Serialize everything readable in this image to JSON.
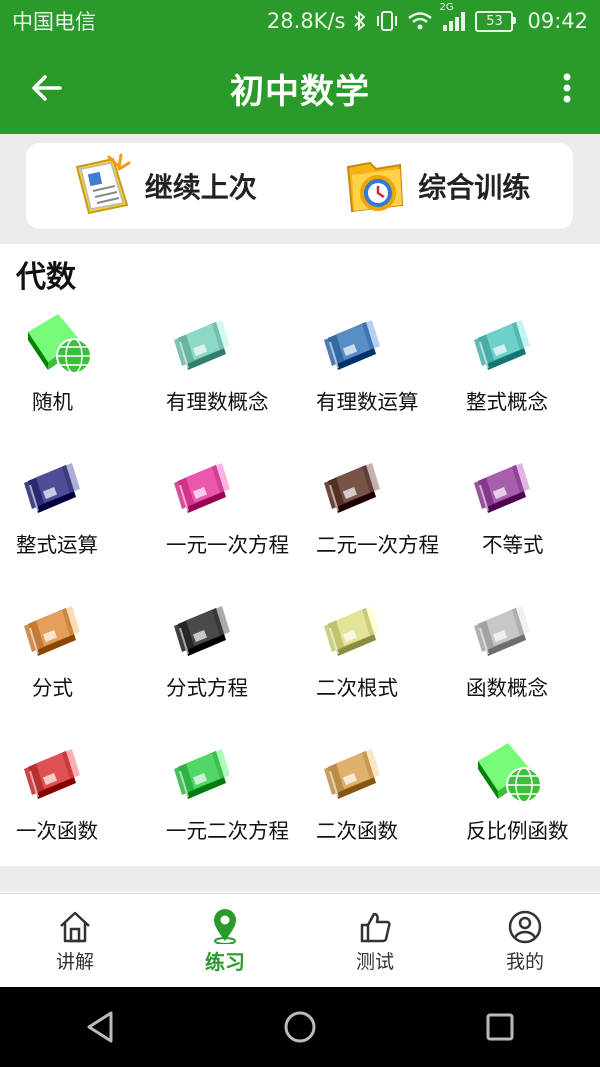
{
  "status_bar": {
    "carrier": "中国电信",
    "speed": "28.8K/s",
    "network": "2G",
    "battery": "53",
    "time": "09:42"
  },
  "app_bar": {
    "title": "初中数学"
  },
  "quick_actions": {
    "continue_label": "继续上次",
    "training_label": "综合训练"
  },
  "section": {
    "title": "代数",
    "items": [
      {
        "label": "随机",
        "icon": "globe-book-icon",
        "color": "#3cbf3c"
      },
      {
        "label": "有理数概念",
        "icon": "book-icon",
        "color": "#6fb9a8"
      },
      {
        "label": "有理数运算",
        "icon": "book-icon",
        "color": "#3a6fa8"
      },
      {
        "label": "整式概念",
        "icon": "book-icon",
        "color": "#4fb3ad"
      },
      {
        "label": "整式运算",
        "icon": "book-icon",
        "color": "#2f2f7a"
      },
      {
        "label": "一元一次方程",
        "icon": "book-icon",
        "color": "#d6388f"
      },
      {
        "label": "二元一次方程",
        "icon": "book-icon",
        "color": "#5a3528"
      },
      {
        "label": "不等式",
        "icon": "book-icon",
        "color": "#8a3f8f"
      },
      {
        "label": "分式",
        "icon": "book-icon",
        "color": "#c9823c"
      },
      {
        "label": "分式方程",
        "icon": "book-icon",
        "color": "#2a2a2a"
      },
      {
        "label": "二次根式",
        "icon": "book-icon",
        "color": "#c5c979"
      },
      {
        "label": "函数概念",
        "icon": "book-icon",
        "color": "#a9a9a9"
      },
      {
        "label": "一次函数",
        "icon": "book-icon",
        "color": "#c23333"
      },
      {
        "label": "一元二次方程",
        "icon": "book-icon",
        "color": "#34b84a"
      },
      {
        "label": "二次函数",
        "icon": "book-icon",
        "color": "#c2934f"
      },
      {
        "label": "反比例函数",
        "icon": "globe-book-icon",
        "color": "#3cbf3c"
      }
    ]
  },
  "bottom_nav": [
    {
      "label": "讲解",
      "icon": "home-icon",
      "active": false
    },
    {
      "label": "练习",
      "icon": "location-pin-icon",
      "active": true
    },
    {
      "label": "测试",
      "icon": "thumbs-up-icon",
      "active": false
    },
    {
      "label": "我的",
      "icon": "user-icon",
      "active": false
    }
  ],
  "colors": {
    "primary": "#2a9a2a",
    "background": "#f1f1f1"
  }
}
